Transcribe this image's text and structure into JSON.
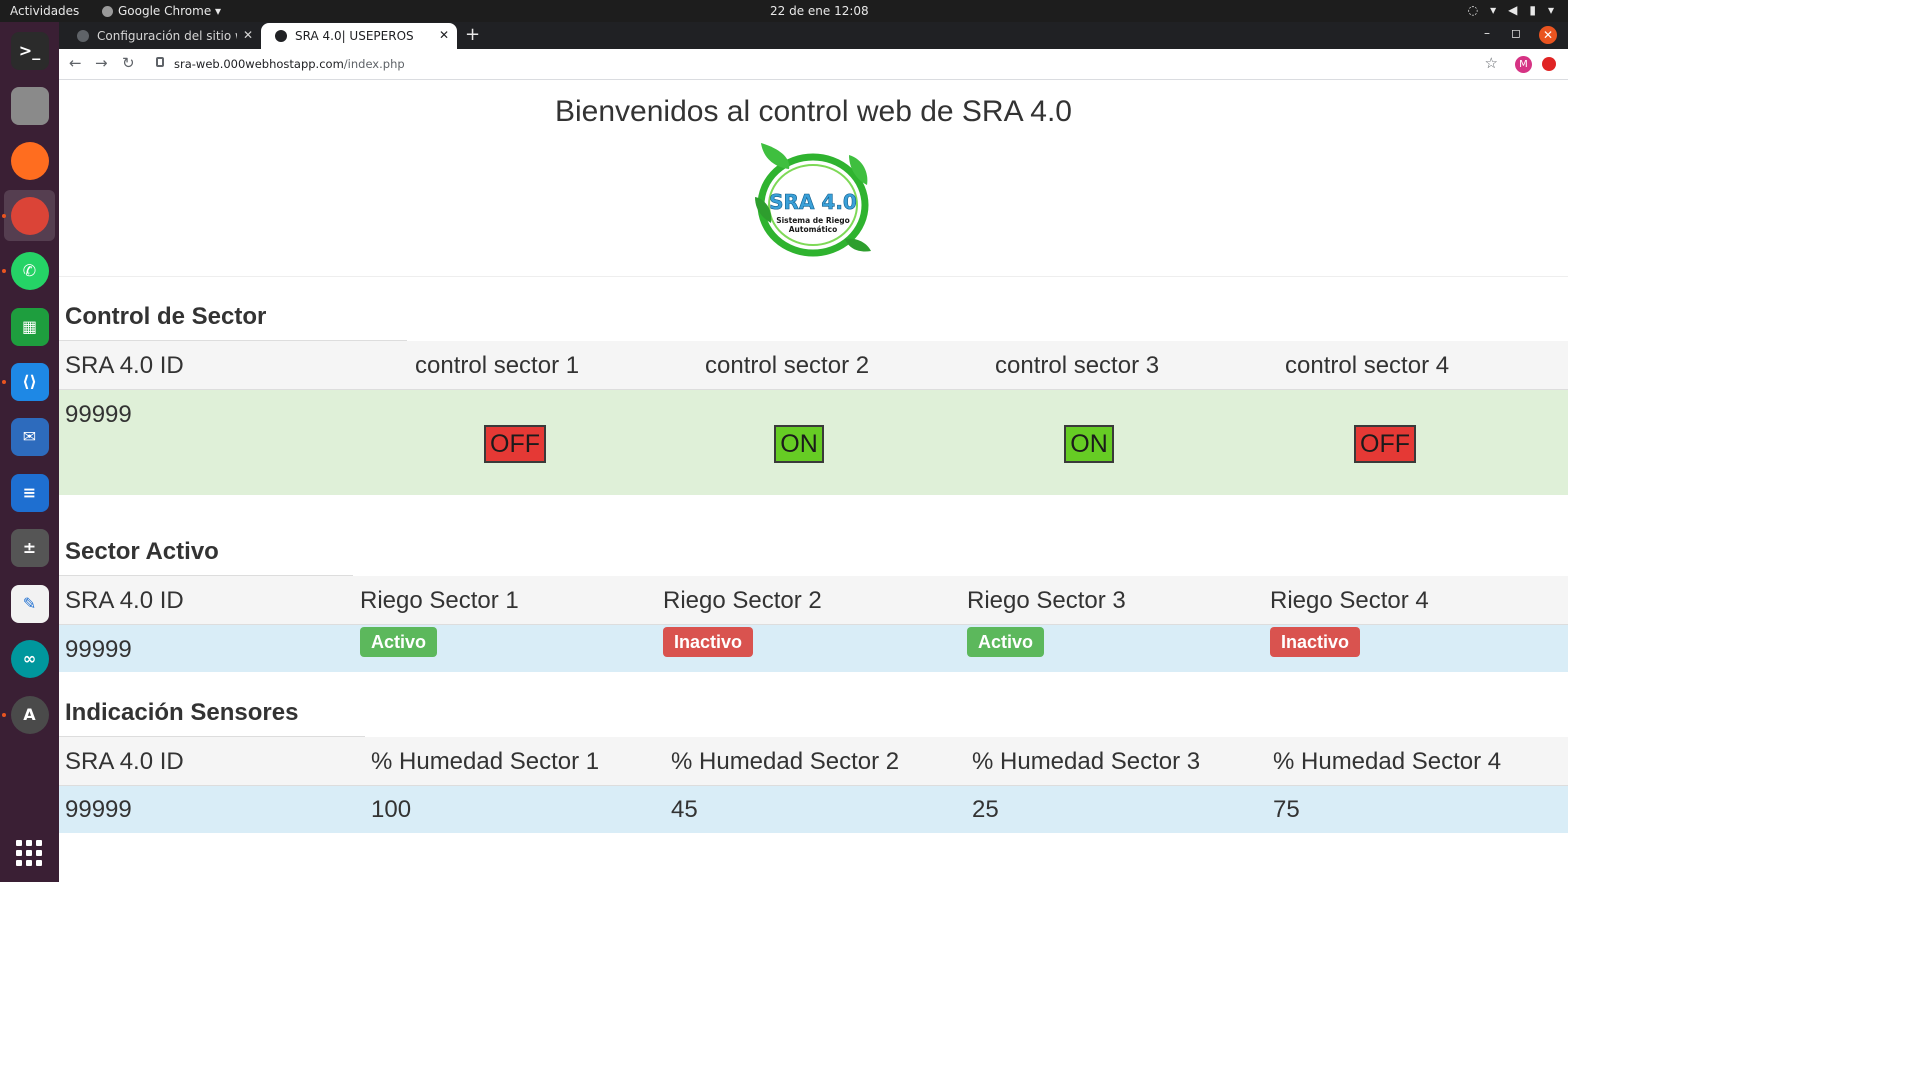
{
  "topbar": {
    "activities": "Actividades",
    "app_name": "Google Chrome ▾",
    "clock": "22 de ene  12:08"
  },
  "dock": {
    "items": [
      {
        "name": "terminal",
        "glyph": ">_",
        "color": "#2b2b2b"
      },
      {
        "name": "files",
        "glyph": "",
        "color": "#8a8a8a"
      },
      {
        "name": "firefox",
        "glyph": "",
        "color": "#ff6d1f"
      },
      {
        "name": "chrome",
        "glyph": "",
        "color": "#db4437"
      },
      {
        "name": "whatsapp",
        "glyph": "✆",
        "color": "#25d366"
      },
      {
        "name": "spreadsheet",
        "glyph": "▦",
        "color": "#1e9e3e"
      },
      {
        "name": "vscode",
        "glyph": "⟨⟩",
        "color": "#1e88e5"
      },
      {
        "name": "thunderbird",
        "glyph": "✉",
        "color": "#2d6bbd"
      },
      {
        "name": "writer",
        "glyph": "≡",
        "color": "#1e6fd1"
      },
      {
        "name": "calculator",
        "glyph": "±",
        "color": "#555555"
      },
      {
        "name": "text-editor",
        "glyph": "✎",
        "color": "#f2f2f2"
      },
      {
        "name": "arduino",
        "glyph": "∞",
        "color": "#00979d"
      },
      {
        "name": "software-updater",
        "glyph": "A",
        "color": "#4a4a4a"
      }
    ]
  },
  "browser": {
    "tabs": [
      {
        "label": "Configuración del sitio web",
        "active": false
      },
      {
        "label": "SRA 4.0| USEPEROS",
        "active": true
      }
    ],
    "new_tab": "+",
    "url_host": "sra-web.000webhostapp.com",
    "url_path": "/index.php",
    "avatar_letter": "M"
  },
  "page": {
    "title": "Bienvenidos al control web de SRA 4.0",
    "logo_title": "SRA 4.0",
    "logo_subtitle": "Sistema de Riego",
    "logo_subtitle2": "Automático"
  },
  "control": {
    "heading": "Control de Sector",
    "columns": [
      "SRA 4.0 ID",
      "control sector 1",
      "control sector 2",
      "control sector 3",
      "control sector 4"
    ],
    "id": "99999",
    "buttons": [
      {
        "label": "OFF",
        "state": "off"
      },
      {
        "label": "ON",
        "state": "on"
      },
      {
        "label": "ON",
        "state": "on"
      },
      {
        "label": "OFF",
        "state": "off"
      }
    ],
    "row_color": "#dff0d8"
  },
  "active": {
    "heading": "Sector Activo",
    "columns": [
      "SRA 4.0 ID",
      "Riego Sector 1",
      "Riego Sector 2",
      "Riego Sector 3",
      "Riego Sector 4"
    ],
    "id": "99999",
    "labels": [
      {
        "label": "Activo",
        "state": "success"
      },
      {
        "label": "Inactivo",
        "state": "danger"
      },
      {
        "label": "Activo",
        "state": "success"
      },
      {
        "label": "Inactivo",
        "state": "danger"
      }
    ],
    "row_color": "#d9edf7"
  },
  "sensors": {
    "heading": "Indicación Sensores",
    "columns": [
      "SRA 4.0 ID",
      "% Humedad Sector 1",
      "% Humedad Sector 2",
      "% Humedad Sector 3",
      "% Humedad Sector 4"
    ],
    "values": [
      "99999",
      "100",
      "45",
      "25",
      "75"
    ],
    "row_color": "#d9edf7"
  },
  "colors": {
    "header_row": "#f5f5f5",
    "btn_on": "#66cc24",
    "btn_off": "#e53935",
    "label_success": "#5cb85c",
    "label_danger": "#d9534f"
  }
}
